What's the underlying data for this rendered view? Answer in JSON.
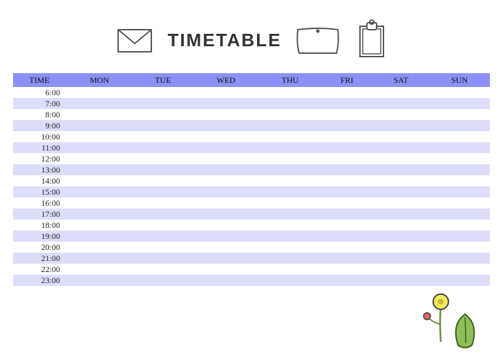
{
  "title": "TIMETABLE",
  "columns": [
    "TIME",
    "MON",
    "TUE",
    "WED",
    "THU",
    "FRI",
    "SAT",
    "SUN"
  ],
  "times": [
    "6:00",
    "7:00",
    "8:00",
    "9:00",
    "10:00",
    "11:00",
    "12:00",
    "13:00",
    "14:00",
    "15:00",
    "16:00",
    "17:00",
    "18:00",
    "19:00",
    "20:00",
    "21:00",
    "22:00",
    "23:00"
  ],
  "colors": {
    "header_band": "#8b90f5",
    "stripe": "#dcddf8"
  }
}
